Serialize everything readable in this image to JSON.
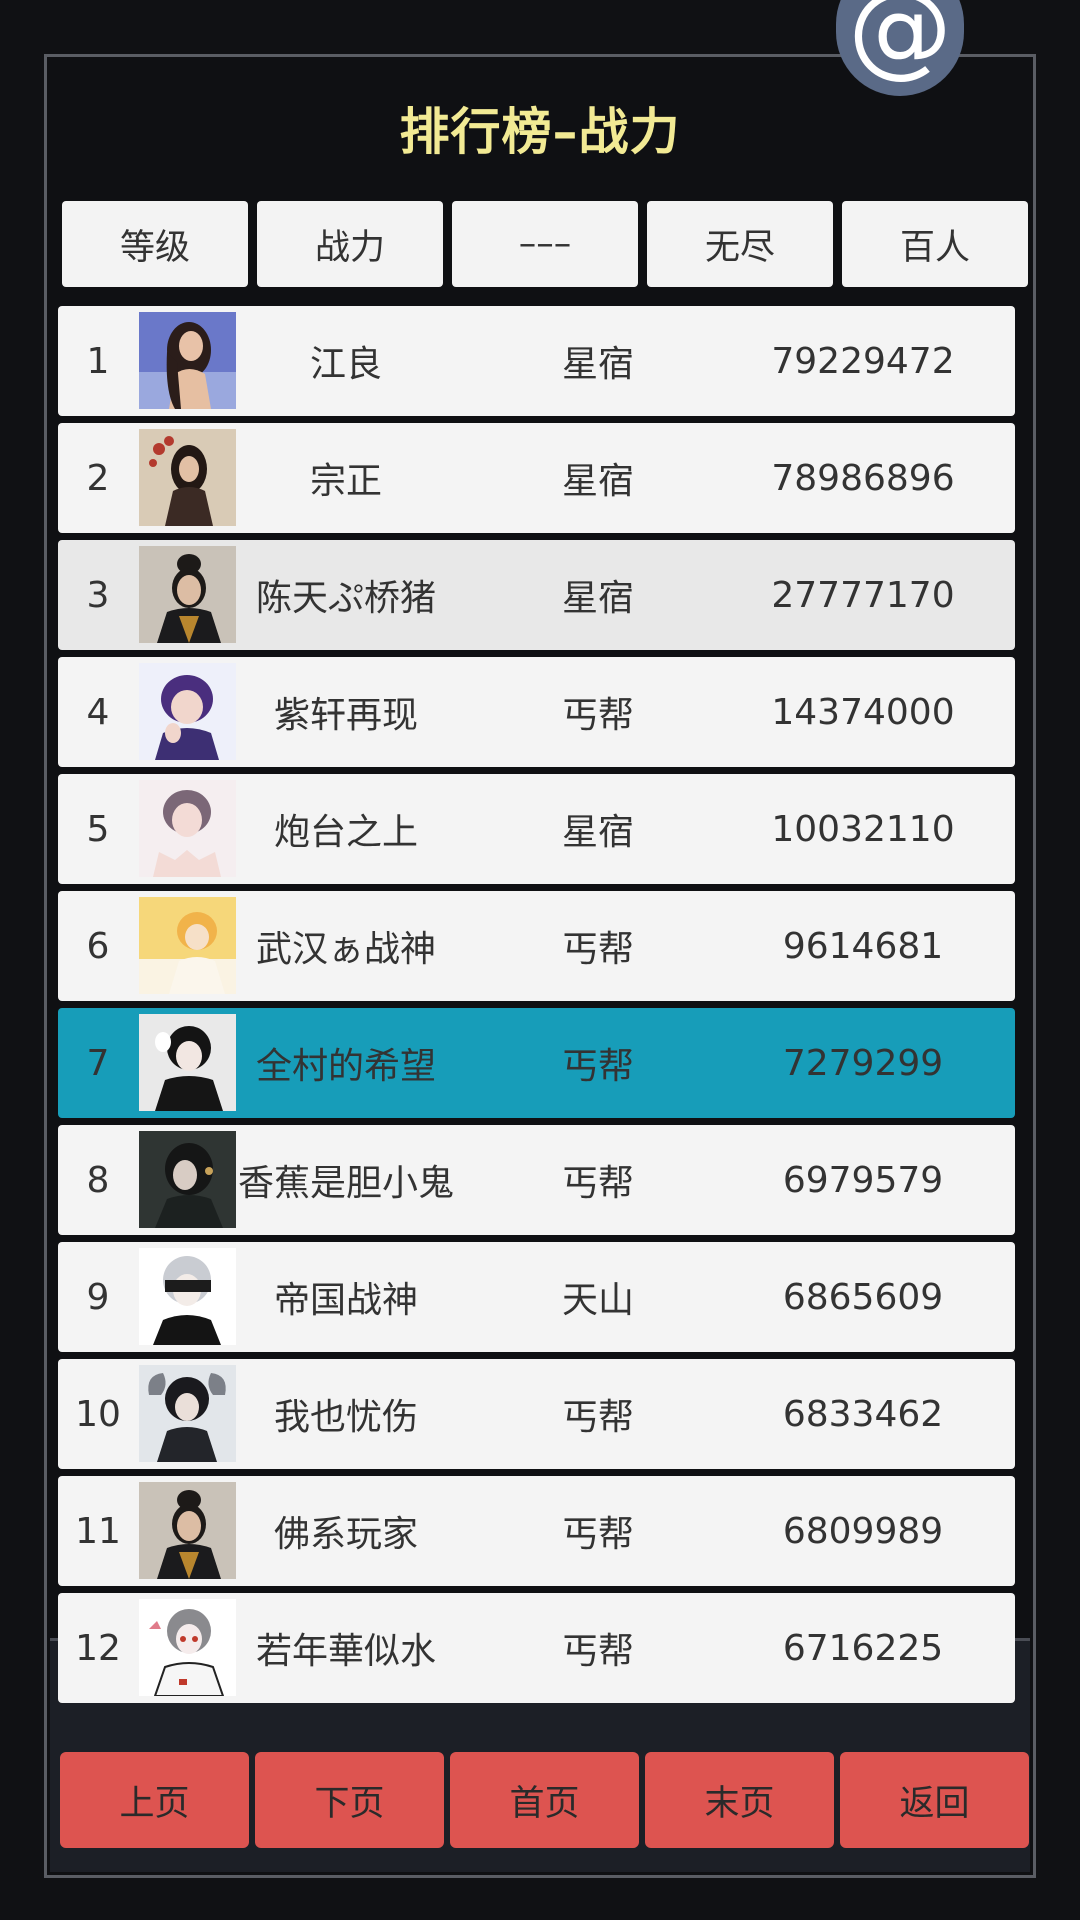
{
  "title": "排行榜–战力",
  "badge": {
    "glyph": "@"
  },
  "tabs": [
    {
      "label": "等级"
    },
    {
      "label": "战力"
    },
    {
      "label": "–––"
    },
    {
      "label": "无尽"
    },
    {
      "label": "百人"
    }
  ],
  "rows": [
    {
      "rank": "1",
      "name": "江良",
      "faction": "星宿",
      "power": "79229472"
    },
    {
      "rank": "2",
      "name": "宗正",
      "faction": "星宿",
      "power": "78986896"
    },
    {
      "rank": "3",
      "name": "陈天ぷ桥猪",
      "faction": "星宿",
      "power": "27777170"
    },
    {
      "rank": "4",
      "name": "紫轩再现",
      "faction": "丐帮",
      "power": "14374000"
    },
    {
      "rank": "5",
      "name": "炮台之上",
      "faction": "星宿",
      "power": "10032110"
    },
    {
      "rank": "6",
      "name": "武汉ぁ战神",
      "faction": "丐帮",
      "power": "9614681"
    },
    {
      "rank": "7",
      "name": "全村的希望",
      "faction": "丐帮",
      "power": "7279299"
    },
    {
      "rank": "8",
      "name": "香蕉是胆小鬼",
      "faction": "丐帮",
      "power": "6979579"
    },
    {
      "rank": "9",
      "name": "帝国战神",
      "faction": "天山",
      "power": "6865609"
    },
    {
      "rank": "10",
      "name": "我也忧伤",
      "faction": "丐帮",
      "power": "6833462"
    },
    {
      "rank": "11",
      "name": "佛系玩家",
      "faction": "丐帮",
      "power": "6809989"
    },
    {
      "rank": "12",
      "name": "若年華似水",
      "faction": "丐帮",
      "power": "6716225"
    }
  ],
  "pager": {
    "prev": "上页",
    "next": "下页",
    "first": "首页",
    "last": "末页",
    "back": "返回"
  },
  "colors": {
    "background": "#101114",
    "title": "#f2ea94",
    "row": "#f4f4f4",
    "row_selected": "#179db9",
    "pager_button": "#dd5450"
  }
}
